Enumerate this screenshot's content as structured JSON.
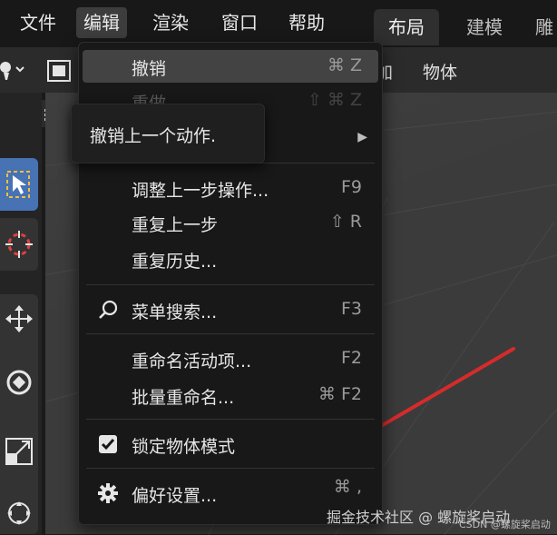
{
  "menubar": {
    "items": [
      {
        "label": "文件"
      },
      {
        "label": "编辑"
      },
      {
        "label": "渲染"
      },
      {
        "label": "窗口"
      },
      {
        "label": "帮助"
      }
    ],
    "workspace_tabs": [
      {
        "label": "布局"
      },
      {
        "label": "建模"
      },
      {
        "label": "雕"
      }
    ]
  },
  "header": {
    "add_label": "加",
    "object_label": "物体"
  },
  "edit_menu": {
    "items": [
      {
        "label": "撤销",
        "shortcut": "⌘ Z"
      },
      {
        "label": "重做",
        "shortcut": "⇧ ⌘ Z"
      },
      {
        "label": "调整上一步操作...",
        "shortcut": "F9"
      },
      {
        "label": "重复上一步",
        "shortcut": "⇧ R"
      },
      {
        "label": "重复历史..."
      },
      {
        "label": "菜单搜索...",
        "shortcut": "F3"
      },
      {
        "label": "重命名活动项...",
        "shortcut": "F2"
      },
      {
        "label": "批量重命名...",
        "shortcut": "⌘ F2"
      },
      {
        "label": "锁定物体模式"
      },
      {
        "label": "偏好设置...",
        "shortcut": "⌘ ,"
      }
    ]
  },
  "tooltip": {
    "text": "撤销上一个动作."
  },
  "watermark": {
    "text": "掘金技术社区 @ 螺旋桨启动",
    "csdn": "CSDN @螺旋桨启动"
  },
  "colors": {
    "accent": "#4772b3",
    "arrow": "#d62b2b",
    "menu_bg": "#181818",
    "highlight": "#434343"
  },
  "icons": [
    "search-icon",
    "checkbox-checked-icon",
    "gear-icon",
    "submenu-arrow-icon",
    "select-box-icon",
    "cursor-icon",
    "move-icon",
    "rotate-icon",
    "scale-icon",
    "transform-icon"
  ]
}
